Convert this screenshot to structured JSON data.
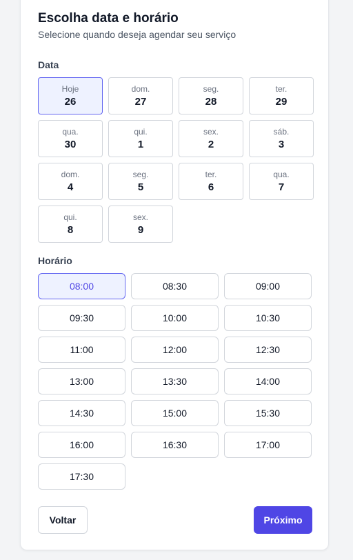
{
  "header": {
    "title": "Escolha data e horário",
    "subtitle": "Selecione quando deseja agendar seu serviço"
  },
  "date_section": {
    "label": "Data",
    "selected_index": 0,
    "dates": [
      {
        "dow": "Hoje",
        "day": "26"
      },
      {
        "dow": "dom.",
        "day": "27"
      },
      {
        "dow": "seg.",
        "day": "28"
      },
      {
        "dow": "ter.",
        "day": "29"
      },
      {
        "dow": "qua.",
        "day": "30"
      },
      {
        "dow": "qui.",
        "day": "1"
      },
      {
        "dow": "sex.",
        "day": "2"
      },
      {
        "dow": "sáb.",
        "day": "3"
      },
      {
        "dow": "dom.",
        "day": "4"
      },
      {
        "dow": "seg.",
        "day": "5"
      },
      {
        "dow": "ter.",
        "day": "6"
      },
      {
        "dow": "qua.",
        "day": "7"
      },
      {
        "dow": "qui.",
        "day": "8"
      },
      {
        "dow": "sex.",
        "day": "9"
      }
    ]
  },
  "time_section": {
    "label": "Horário",
    "selected_index": 0,
    "times": [
      "08:00",
      "08:30",
      "09:00",
      "09:30",
      "10:00",
      "10:30",
      "11:00",
      "12:00",
      "12:30",
      "13:00",
      "13:30",
      "14:00",
      "14:30",
      "15:00",
      "15:30",
      "16:00",
      "16:30",
      "17:00",
      "17:30"
    ]
  },
  "footer": {
    "back_label": "Voltar",
    "next_label": "Próximo"
  },
  "colors": {
    "accent": "#4f46e5",
    "accent_border": "#6366f1",
    "selected_bg": "#eef2ff"
  }
}
